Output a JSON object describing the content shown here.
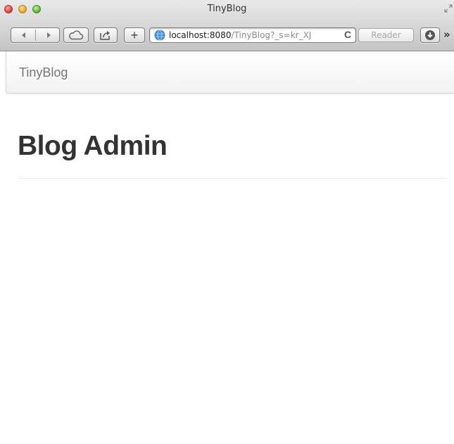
{
  "window": {
    "title": "TinyBlog"
  },
  "toolbar": {
    "back_icon": "back-arrow-icon",
    "forward_icon": "forward-arrow-icon",
    "cloud_icon": "icloud-tabs-icon",
    "share_icon": "share-icon",
    "new_tab_label": "+",
    "reader_label": "Reader",
    "more_label": "»"
  },
  "address_bar": {
    "host": "localhost:8080",
    "path": "/TinyBlog?_s=kr_XJ",
    "reload_label": "C"
  },
  "navbar": {
    "brand": "TinyBlog"
  },
  "main": {
    "heading": "Blog Admin"
  },
  "colors": {
    "heading": "#333333",
    "brand": "#777777",
    "url_host": "#1a1a1a",
    "url_path": "#8a8a8a"
  }
}
